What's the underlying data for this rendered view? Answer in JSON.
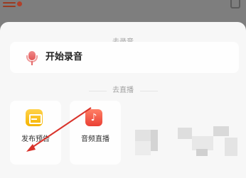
{
  "record_section": {
    "divider_label": "去录音",
    "record_button_label": "开始录音",
    "icon": "microphone-icon"
  },
  "live_section": {
    "divider_label": "去直播",
    "tiles": [
      {
        "label": "发布预告",
        "icon": "schedule-briefcase-icon",
        "color": "#f5b400"
      },
      {
        "label": "音频直播",
        "icon": "music-note-icon",
        "color": "#ea3f34"
      }
    ]
  },
  "annotation": {
    "arrow_color": "#d9332b"
  }
}
